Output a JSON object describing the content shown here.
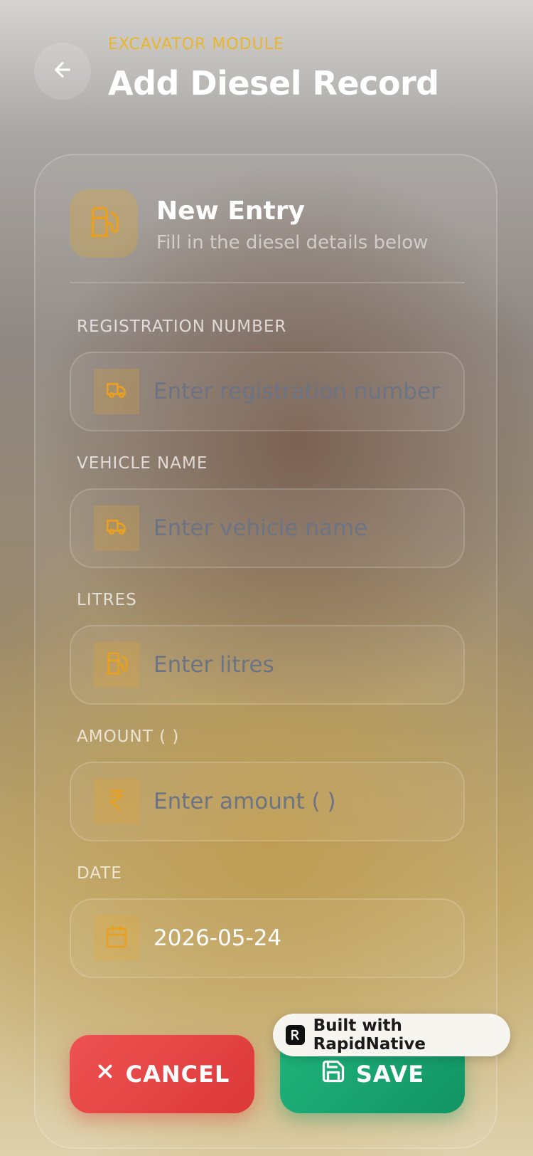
{
  "header": {
    "module_label": "EXCAVATOR MODULE",
    "title": "Add Diesel Record",
    "back_icon": "arrow-left-icon"
  },
  "entry": {
    "title": "New Entry",
    "subtitle": "Fill in the diesel details below",
    "icon": "fuel-pump-icon"
  },
  "fields": {
    "registration": {
      "label": "REGISTRATION NUMBER",
      "placeholder": "Enter registration number",
      "value": "",
      "icon": "truck-icon"
    },
    "vehicle": {
      "label": "VEHICLE NAME",
      "placeholder": "Enter vehicle name",
      "value": "",
      "icon": "truck-icon"
    },
    "litres": {
      "label": "LITRES",
      "placeholder": "Enter litres",
      "value": "",
      "icon": "fuel-pump-icon"
    },
    "amount": {
      "label": "AMOUNT (  )",
      "placeholder": "Enter amount (  )",
      "value": "",
      "icon": "rupee-icon"
    },
    "date": {
      "label": "DATE",
      "value": "2026-05-24",
      "icon": "calendar-icon"
    }
  },
  "actions": {
    "cancel_label": "CANCEL",
    "save_label": "SAVE"
  },
  "badge": {
    "text": "Built with RapidNative"
  },
  "colors": {
    "accent": "#e8a020",
    "cancel": "#e24444",
    "save": "#17a36f"
  }
}
